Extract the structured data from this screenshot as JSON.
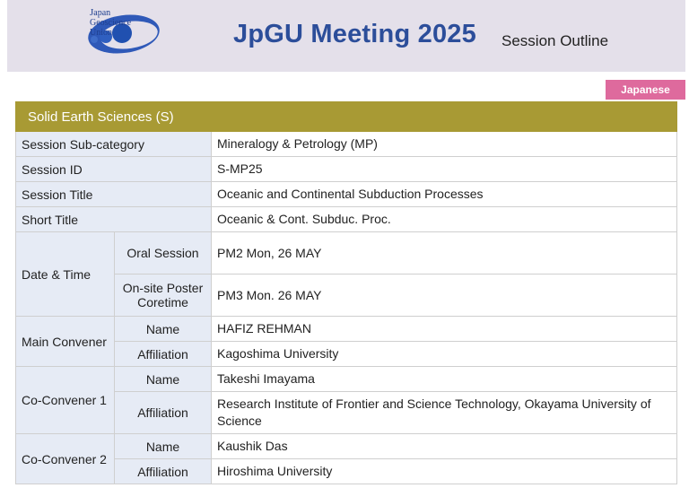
{
  "header": {
    "logo_lines": [
      "apan",
      "Geoscience",
      "Union"
    ],
    "logo_initial": "J",
    "meeting_title": "JpGU Meeting 2025",
    "subtitle": "Session Outline"
  },
  "language_button": "Japanese",
  "category": "Solid Earth Sciences (S)",
  "colors": {
    "header_bg": "#e4e0ea",
    "title_blue": "#2c4e9a",
    "category_bg": "#a89a34",
    "label_bg": "#e6ebf5",
    "language_button_bg": "#de6a9d"
  },
  "rows": {
    "sub_category": {
      "label": "Session Sub-category",
      "value": "Mineralogy & Petrology (MP)"
    },
    "session_id": {
      "label": "Session ID",
      "value": "S-MP25"
    },
    "session_title": {
      "label": "Session Title",
      "value": "Oceanic and Continental Subduction Processes"
    },
    "short_title": {
      "label": "Short Title",
      "value": "Oceanic & Cont. Subduc. Proc."
    },
    "date_time": {
      "label": "Date & Time",
      "oral_label": "Oral Session",
      "oral_value": "PM2 Mon, 26 MAY",
      "poster_label": "On-site Poster Coretime",
      "poster_value": "PM3 Mon. 26 MAY"
    },
    "main_convener": {
      "label": "Main Convener",
      "name_label": "Name",
      "name": "HAFIZ REHMAN",
      "affiliation_label": "Affiliation",
      "affiliation": "Kagoshima University"
    },
    "co_convener_1": {
      "label": "Co-Convener 1",
      "name_label": "Name",
      "name": "Takeshi Imayama",
      "affiliation_label": "Affiliation",
      "affiliation": "Research Institute of Frontier and Science Technology, Okayama University of Science"
    },
    "co_convener_2": {
      "label": "Co-Convener 2",
      "name_label": "Name",
      "name": "Kaushik Das",
      "affiliation_label": "Affiliation",
      "affiliation": "Hiroshima University"
    }
  }
}
